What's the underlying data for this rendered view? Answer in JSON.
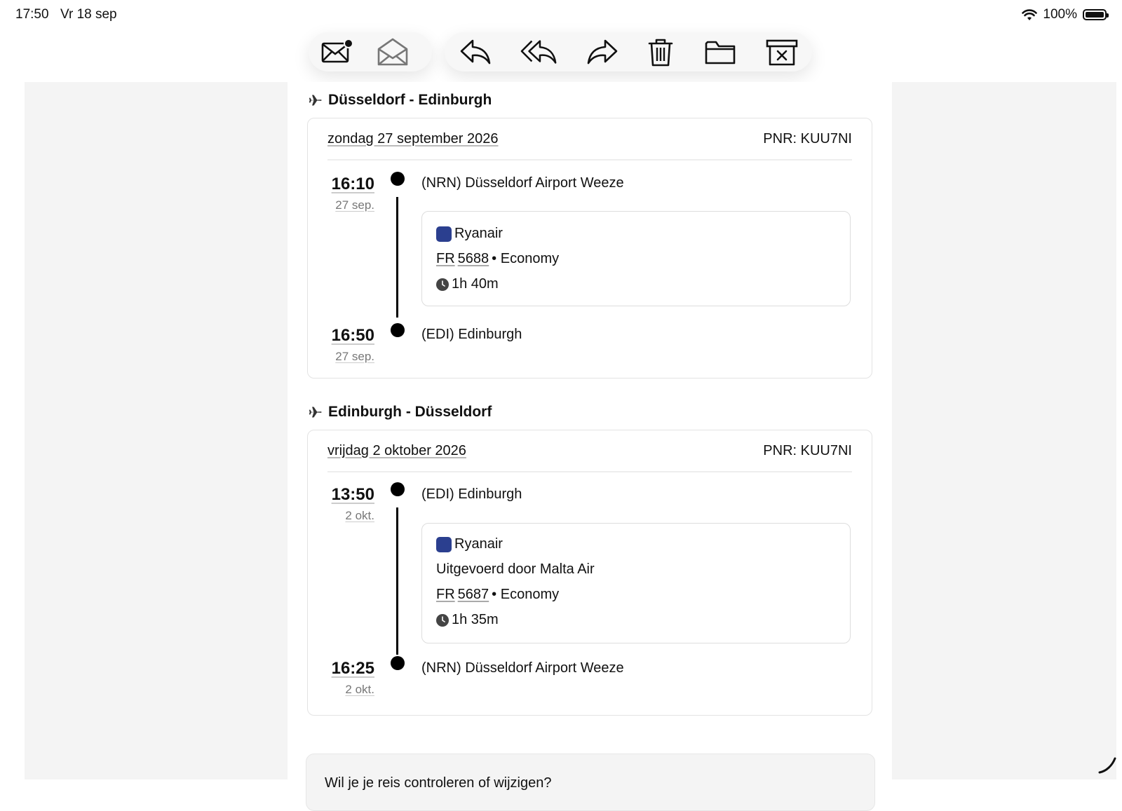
{
  "status_bar": {
    "time": "17:50",
    "date": "Vr 18 sep",
    "battery": "100%"
  },
  "toolbar": {
    "buttons": [
      "unread-mail",
      "open-mail",
      "reply",
      "reply-all",
      "forward",
      "trash",
      "folder",
      "junk"
    ]
  },
  "legs": [
    {
      "title": "Düsseldorf - Edinburgh",
      "date": "zondag 27 september 2026",
      "pnr": "PNR: KUU7NI",
      "departure": {
        "time": "16:10",
        "day": "27 sep.",
        "station": "(NRN) Düsseldorf Airport Weeze"
      },
      "airline": "Ryanair",
      "carrier_code": "FR",
      "flight_number": "5688",
      "cabin": "• Economy",
      "duration": "1h 40m",
      "arrival": {
        "time": "16:50",
        "day": "27 sep.",
        "station": "(EDI) Edinburgh"
      }
    },
    {
      "title": "Edinburgh - Düsseldorf",
      "date": "vrijdag 2 oktober 2026",
      "pnr": "PNR: KUU7NI",
      "departure": {
        "time": "13:50",
        "day": "2 okt.",
        "station": "(EDI) Edinburgh"
      },
      "airline": "Ryanair",
      "operated_by": "Uitgevoerd door Malta Air",
      "carrier_code": "FR",
      "flight_number": "5687",
      "cabin": "• Economy",
      "duration": "1h 35m",
      "arrival": {
        "time": "16:25",
        "day": "2 okt.",
        "station": "(NRN) Düsseldorf Airport Weeze"
      }
    }
  ],
  "footer_prompt": "Wil je je reis controleren of wijzigen?"
}
